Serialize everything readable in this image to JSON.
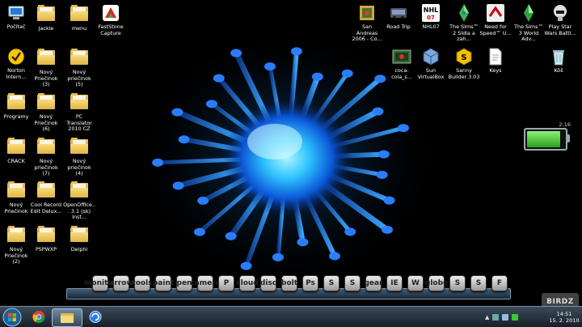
{
  "desktop_icons_left": [
    {
      "label": "Počítač",
      "icon": "computer-icon"
    },
    {
      "label": "Jackie",
      "icon": "folder-icon"
    },
    {
      "label": "menu",
      "icon": "folder-icon"
    },
    {
      "label": "FastStone Capture",
      "icon": "faststone-capture-icon"
    },
    {
      "label": "Norton Intern...",
      "icon": "norton-icon"
    },
    {
      "label": "Nový Priečinok (3)",
      "icon": "folder-icon"
    },
    {
      "label": "Nový priečinok (5)",
      "icon": "folder-icon"
    },
    {
      "label": "Programy",
      "icon": "folder-icon"
    },
    {
      "label": "Nový Priečinok (6)",
      "icon": "folder-icon"
    },
    {
      "label": "PC Translator 2010 CZ",
      "icon": "folder-icon"
    },
    {
      "label": "CRACK",
      "icon": "folder-icon"
    },
    {
      "label": "Nový priečinok (7)",
      "icon": "folder-icon"
    },
    {
      "label": "Nový priečinok (4)",
      "icon": "folder-icon"
    },
    {
      "label": "Nový Priečinok",
      "icon": "folder-icon"
    },
    {
      "label": "Cool Record Edit Delux...",
      "icon": "folder-icon"
    },
    {
      "label": "OpenOffice... 3.1 (sk) Inst...",
      "icon": "folder-icon"
    },
    {
      "label": "Nový Priečinok (2)",
      "icon": "folder-icon"
    },
    {
      "label": "PSPWXP",
      "icon": "folder-icon"
    },
    {
      "label": "Delphi",
      "icon": "folder-icon"
    }
  ],
  "desktop_icons_right": [
    {
      "label": "San Andreas 2006 - Co...",
      "icon": "san-andreas-icon"
    },
    {
      "label": "Road Trip",
      "icon": "road-trip-icon"
    },
    {
      "label": "NHL07",
      "icon": "nhl07-icon"
    },
    {
      "label": "The Sims™ 2 Sídla a zah...",
      "icon": "sims2-icon"
    },
    {
      "label": "Need for Speed™ U...",
      "icon": "need-for-speed-icon"
    },
    {
      "label": "The Sims™ 3 World Adv...",
      "icon": "sims3-icon"
    },
    {
      "label": "Play Star Wars Battl...",
      "icon": "star-wars-icon"
    },
    {
      "label": "coca-cola_s...",
      "icon": "coca-cola-image-icon"
    },
    {
      "label": "Sun VirtualBox",
      "icon": "virtualbox-icon"
    },
    {
      "label": "Sanny Builder 3.03",
      "icon": "sanny-builder-icon"
    },
    {
      "label": "Keys",
      "icon": "text-file-icon"
    },
    {
      "label": "Kôš",
      "icon": "recycle-bin-icon"
    }
  ],
  "battery_gadget": {
    "time": "2:16",
    "level": 0.9
  },
  "taskbar": {
    "clock_time": "14:51",
    "clock_date": "15. 2. 2010",
    "pinned": [
      {
        "name": "start-orb-button",
        "icon": "windows-logo-icon"
      },
      {
        "name": "chrome-taskbar-button",
        "icon": "chrome-icon"
      },
      {
        "name": "explorer-taskbar-button",
        "icon": "folder-icon"
      },
      {
        "name": "app-taskbar-button",
        "icon": "app-icon"
      }
    ]
  },
  "dock_items": [
    "monitor",
    "arrow",
    "tools",
    "paint",
    "pen",
    "camera",
    "P",
    "cloud",
    "disc",
    "bolt",
    "Ps",
    "S",
    "S",
    "gear",
    "IE",
    "W",
    "globe",
    "S",
    "S",
    "F"
  ],
  "watermark": "BIRDZ",
  "colors": {
    "accent_blue": "#1a7bff",
    "battery_green": "#3cc42a"
  }
}
